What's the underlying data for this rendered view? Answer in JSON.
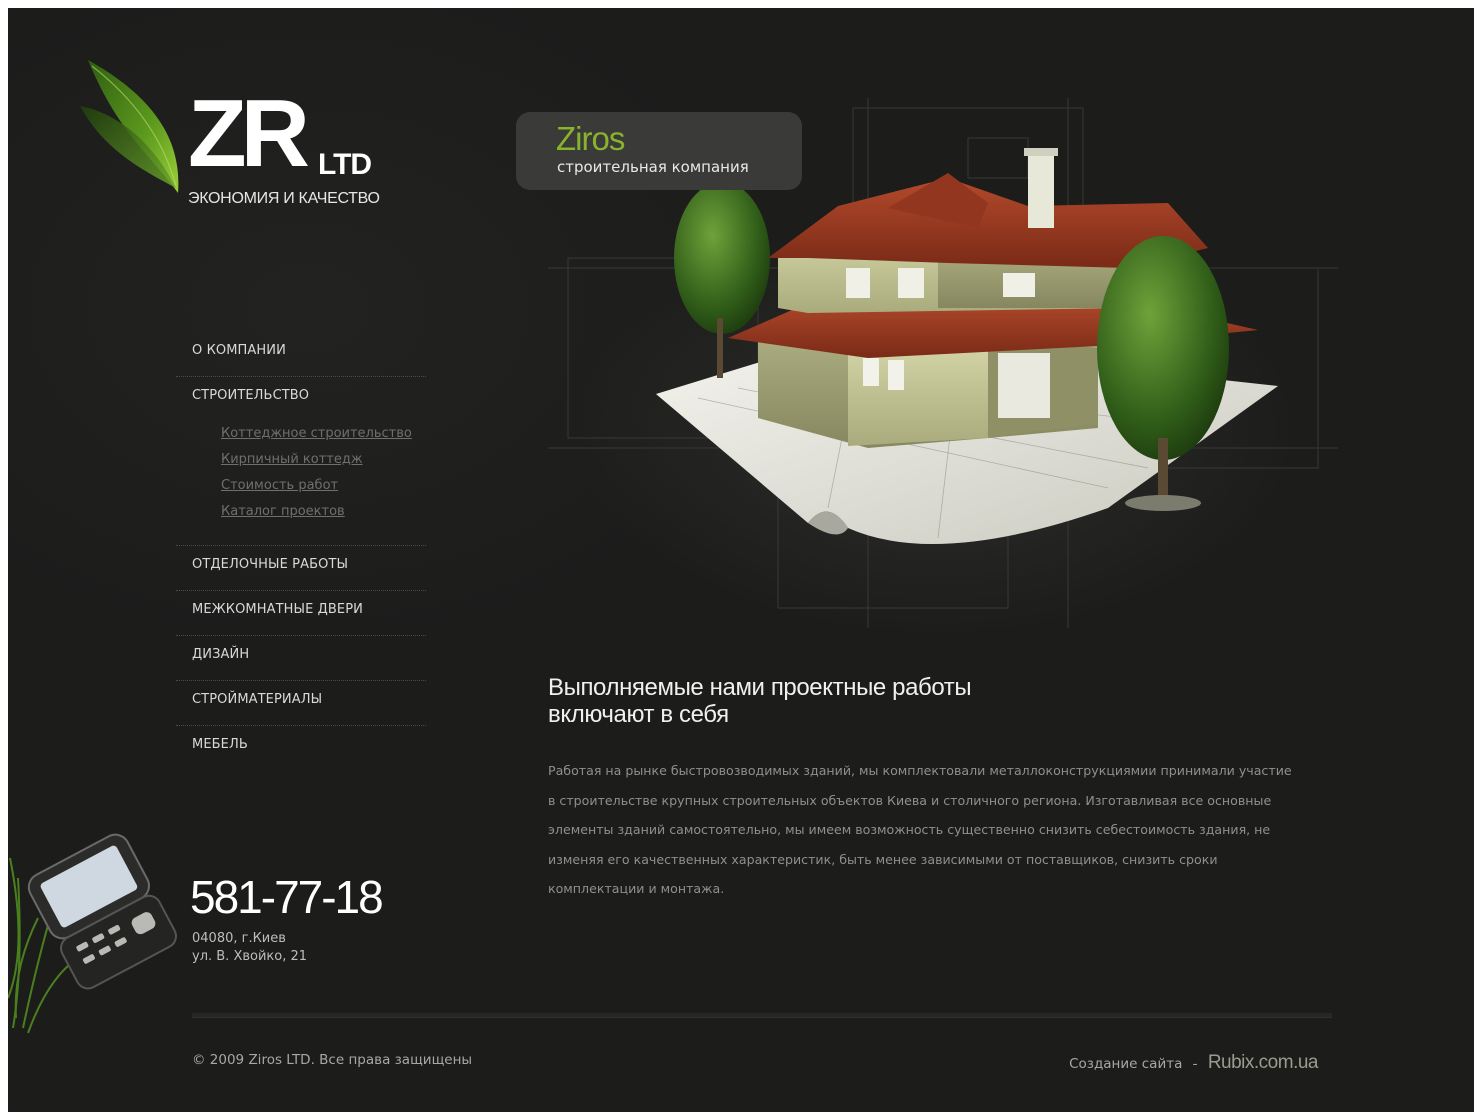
{
  "logo": {
    "mark": "ZR",
    "suffix": "LTD",
    "slogan": "ЭКОНОМИЯ И КАЧЕСТВО"
  },
  "hero": {
    "company_name": "Ziros",
    "company_tagline": "строительная компания"
  },
  "nav": {
    "items": [
      {
        "label": "О КОМПАНИИ"
      },
      {
        "label": "СТРОИТЕЛЬСТВО"
      },
      {
        "label": "ОТДЕЛОЧНЫЕ РАБОТЫ"
      },
      {
        "label": "МЕЖКОМНАТНЫЕ ДВЕРИ"
      },
      {
        "label": "ДИЗАЙН"
      },
      {
        "label": "СТРОЙМАТЕРИАЛЫ"
      },
      {
        "label": "МЕБЕЛЬ"
      }
    ],
    "subitems": [
      {
        "label": "Коттеджное строительство"
      },
      {
        "label": "Кирпичный коттедж"
      },
      {
        "label": "Стоимость работ"
      },
      {
        "label": "Каталог проектов"
      }
    ]
  },
  "content": {
    "headline_line1": "Выполняемые нами проектные работы",
    "headline_line2": "включают в себя",
    "body_lines": [
      "Работая на рынке быстровозводимых зданий, мы комплектовали металлоконструкциямии принимали участие",
      "в строительстве крупных строительных объектов Киева и столичного региона. Изготавливая все основные",
      "элементы зданий самостоятельно, мы имеем возможность существенно снизить себестоимость здания, не",
      "изменяя его качественных характеристик, быть менее зависимыми от поставщиков, снизить сроки",
      "комплектации и монтажа."
    ]
  },
  "contact": {
    "phone": "581-77-18",
    "address_line1": "04080, г.Киев",
    "address_line2": "ул. В. Хвойко, 21"
  },
  "footer": {
    "copyright": "© 2009 Ziros LTD. Все права защищены",
    "credit_label": "Создание сайта",
    "credit_separator": "-",
    "credit_link": "Rubix.com.ua"
  },
  "colors": {
    "background": "#1c1c1b",
    "accent_green": "#8ab32d",
    "text_light": "#d9d9d9",
    "text_muted": "#8f8f8c"
  }
}
